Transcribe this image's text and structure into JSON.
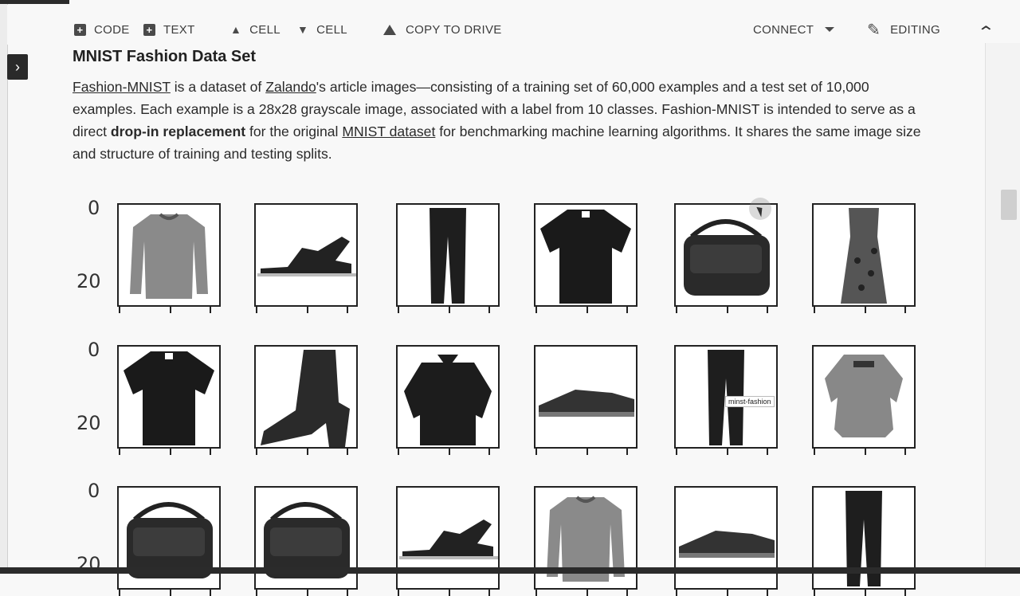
{
  "toolbar": {
    "code": "CODE",
    "text": "TEXT",
    "cell_up": "CELL",
    "cell_down": "CELL",
    "copy_to_drive": "COPY TO DRIVE",
    "connect": "CONNECT",
    "editing": "EDITING"
  },
  "cell": {
    "title": "MNIST Fashion Data Set",
    "p_link1": "Fashion-MNIST",
    "p_t1": " is a dataset of ",
    "p_link2": "Zalando",
    "p_t2": "'s article images—consisting of a training set of 60,000 examples and a test set of 10,000 examples. Each example is a 28x28 grayscale image, associated with a label from 10 classes. Fashion-MNIST is intended to serve as a direct ",
    "p_bold": "drop-in replacement",
    "p_t3": " for the original ",
    "p_link3": "MNIST dataset",
    "p_t4": " for benchmarking machine learning algorithms. It shares the same image size and structure of training and testing splits."
  },
  "grid": {
    "ytick_0": "0",
    "ytick_20": "20",
    "rows": [
      [
        "pullover-image",
        "sandal-image",
        "trouser-image",
        "tshirt-image",
        "bag-image",
        "dress-image"
      ],
      [
        "tshirt-image",
        "ankle-boot-image",
        "shirt-image",
        "sneaker-image",
        "trouser-image",
        "top-image"
      ],
      [
        "bag-image",
        "bag-image",
        "sandal-image",
        "pullover-image",
        "sneaker-image",
        "trouser-image"
      ]
    ],
    "tooltip": "minst-fashion"
  }
}
